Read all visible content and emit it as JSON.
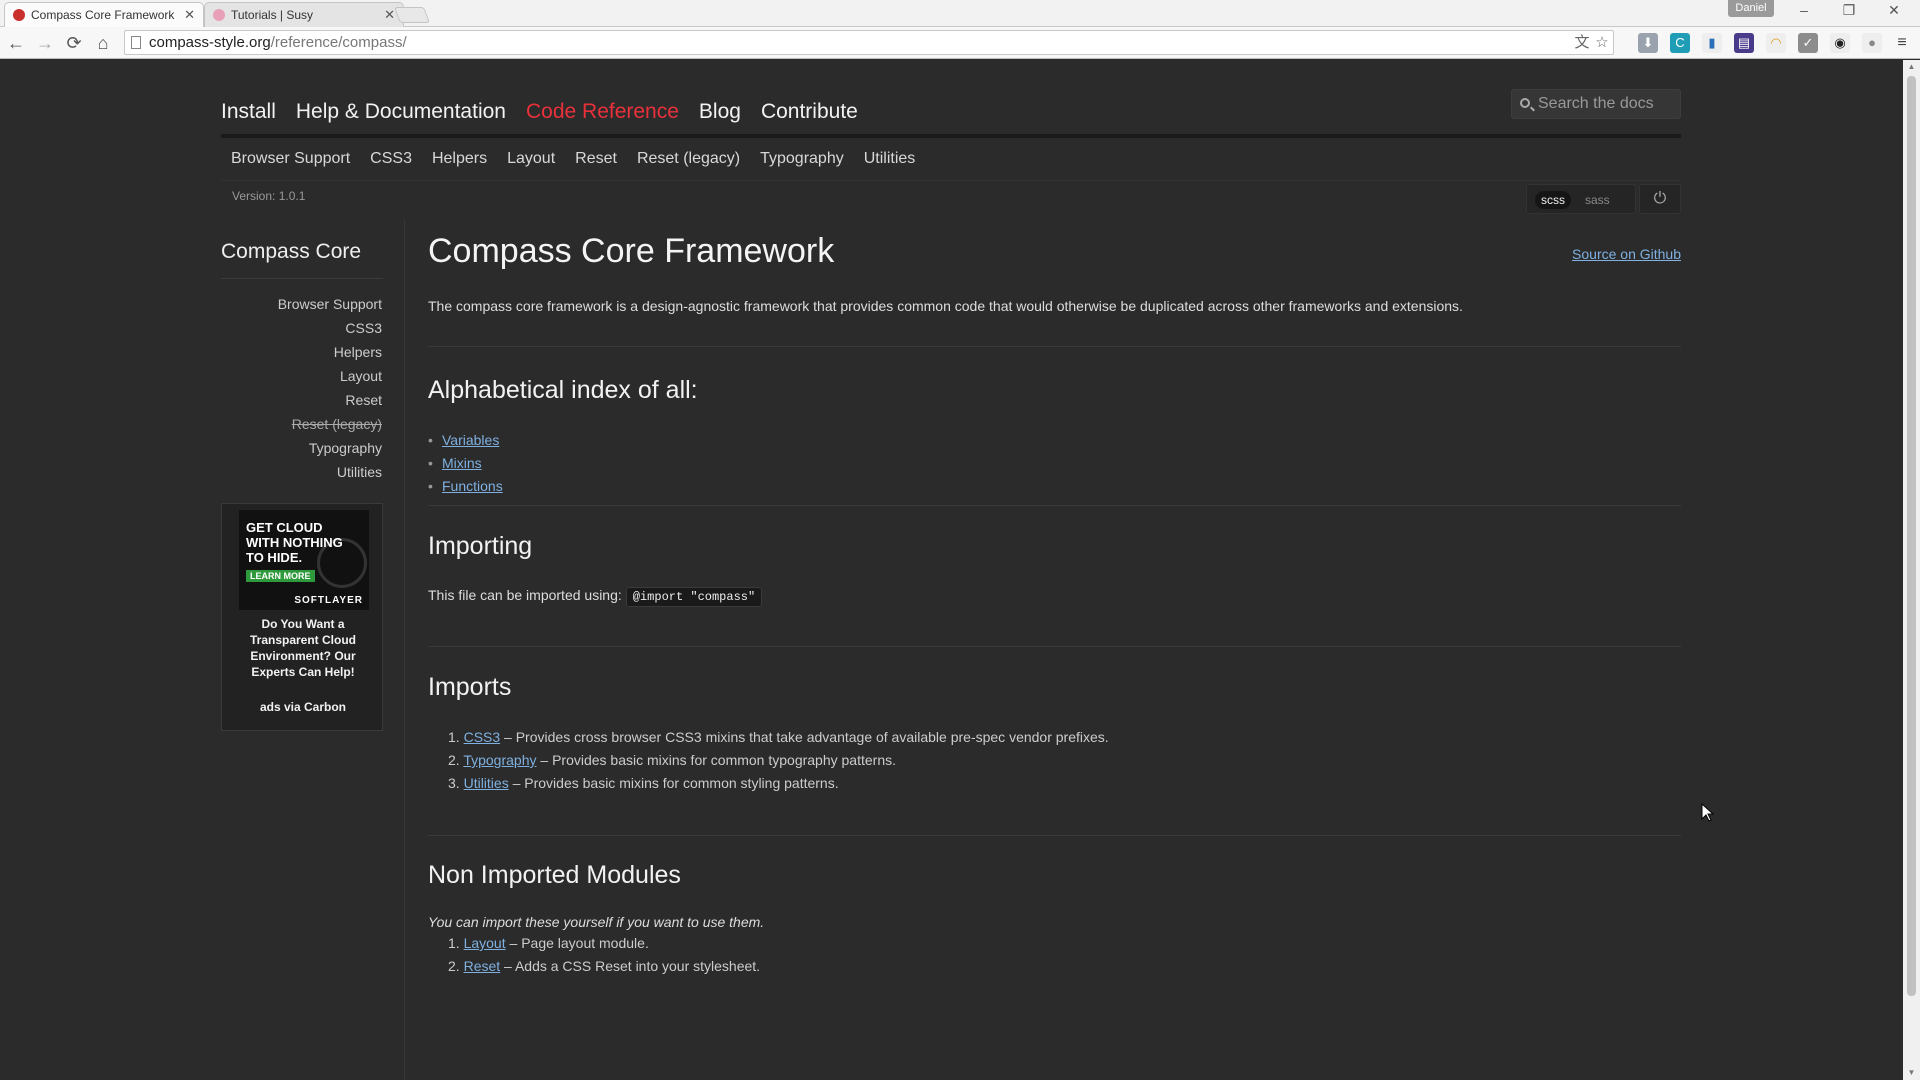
{
  "browser": {
    "tabs": [
      {
        "label": "Compass Core Framework",
        "active": true
      },
      {
        "label": "Tutorials | Susy",
        "active": false
      }
    ],
    "user_badge": "Daniel",
    "window_controls": {
      "minimize": "–",
      "restore": "❐",
      "close": "✕"
    },
    "nav": {
      "back": "←",
      "forward": "→",
      "reload": "⟳",
      "home": "⌂"
    },
    "address": {
      "host": "compass-style.org",
      "path": "/reference/compass/"
    }
  },
  "site": {
    "main_nav": [
      "Install",
      "Help & Documentation",
      "Code Reference",
      "Blog",
      "Contribute"
    ],
    "active_main": "Code Reference",
    "search_placeholder": "Search the docs",
    "sub_nav": [
      "Browser Support",
      "CSS3",
      "Helpers",
      "Layout",
      "Reset",
      "Reset (legacy)",
      "Typography",
      "Utilities"
    ],
    "version": "Version: 1.0.1",
    "syntax": {
      "scss": "scss",
      "sass": "sass"
    },
    "power_icon": "⏻"
  },
  "sidebar": {
    "title": "Compass Core",
    "items": [
      "Browser Support",
      "CSS3",
      "Helpers",
      "Layout",
      "Reset",
      "Reset (legacy)",
      "Typography",
      "Utilities"
    ],
    "ad": {
      "headline_1": "GET CLOUD",
      "headline_2": "WITH NOTHING",
      "headline_3": "TO HIDE.",
      "learn_more": "LEARN MORE",
      "brand": "SOFTLAYER",
      "text": "Do You Want a Transparent Cloud Environment? Our Experts Can Help!",
      "credit": "ads via Carbon"
    }
  },
  "content": {
    "title": "Compass Core Framework",
    "source_link": "Source on Github",
    "intro": "The compass core framework is a design-agnostic framework that provides common code that would otherwise be duplicated across other frameworks and extensions.",
    "index_heading": "Alphabetical index of all:",
    "index_links": [
      "Variables",
      "Mixins",
      "Functions"
    ],
    "importing_heading": "Importing",
    "importing_text": "This file can be imported using:",
    "importing_code": "@import \"compass\"",
    "imports_heading": "Imports",
    "imports": [
      {
        "num": "1.",
        "link": "CSS3",
        "desc": " – Provides cross browser CSS3 mixins that take advantage of available pre-spec vendor prefixes."
      },
      {
        "num": "2.",
        "link": "Typography",
        "desc": " – Provides basic mixins for common typography patterns."
      },
      {
        "num": "3.",
        "link": "Utilities",
        "desc": " – Provides basic mixins for common styling patterns."
      }
    ],
    "nonimported_heading": "Non Imported Modules",
    "nonimported_note": "You can import these yourself if you want to use them.",
    "nonimported": [
      {
        "num": "1.",
        "link": "Layout",
        "desc": " – Page layout module."
      },
      {
        "num": "2.",
        "link": "Reset",
        "desc": " – Adds a CSS Reset into your stylesheet."
      }
    ]
  },
  "colors": {
    "accent": "#e8313b",
    "link": "#7fb0e0",
    "background": "#2b2b2b"
  }
}
